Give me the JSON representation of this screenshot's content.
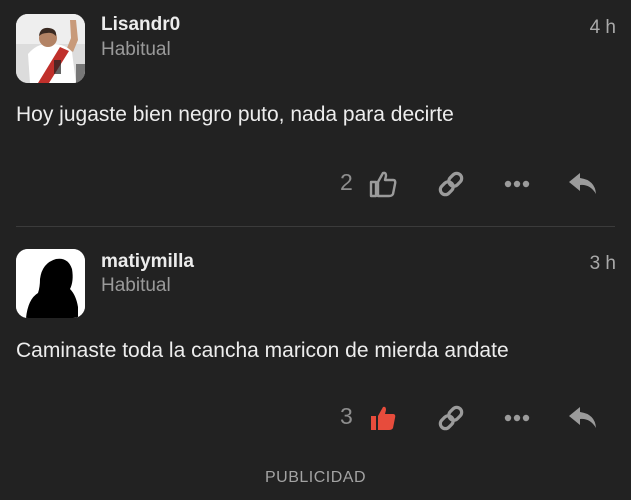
{
  "posts": [
    {
      "username": "Lisandr0",
      "user_title": "Habitual",
      "timestamp": "4 h",
      "body": "Hoy jugaste bien negro puto, nada para decirte",
      "like_count": "2",
      "liked": false,
      "avatar": "player-photo"
    },
    {
      "username": "matiymilla",
      "user_title": "Habitual",
      "timestamp": "3 h",
      "body": "Caminaste toda la cancha maricon de mierda andate",
      "like_count": "3",
      "liked": true,
      "avatar": "silhouette"
    }
  ],
  "icons": {
    "like": "thumbs-up-icon",
    "link": "link-icon",
    "more": "ellipsis-icon",
    "reply": "reply-icon"
  },
  "colors": {
    "background": "#222222",
    "liked_accent": "#e74c3c",
    "icon_gray": "#9b9b9b"
  },
  "ad_label": "PUBLICIDAD"
}
